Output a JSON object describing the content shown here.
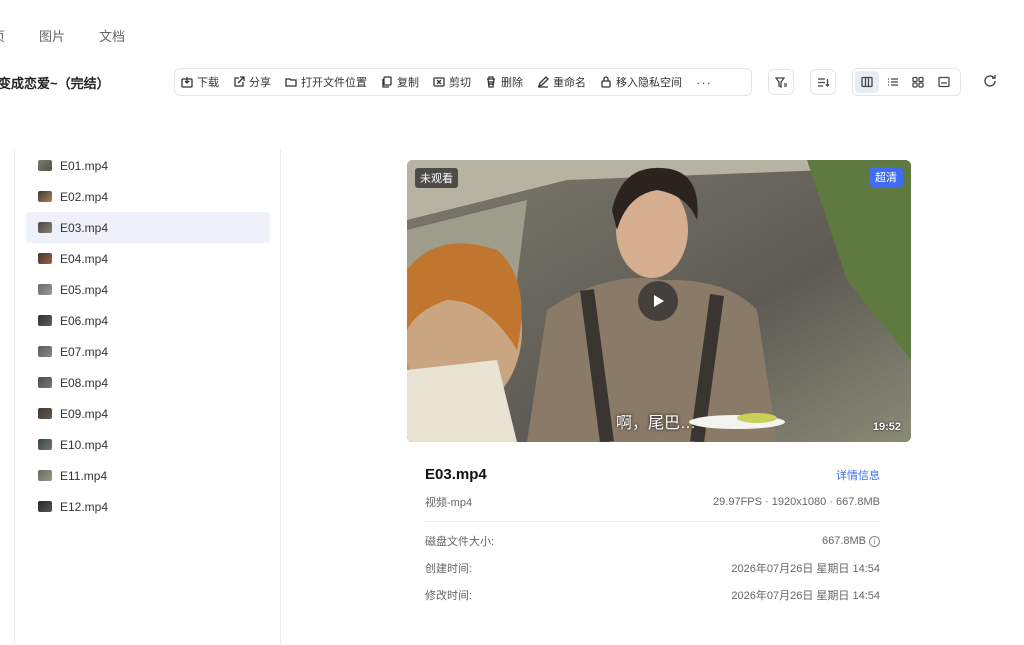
{
  "tabs": [
    "页",
    "图片",
    "文档"
  ],
  "folder_title": "变成恋爱~（完结）",
  "toolbar": {
    "download": "下载",
    "share": "分享",
    "open_location": "打开文件位置",
    "copy": "复制",
    "cut": "剪切",
    "delete": "删除",
    "rename": "重命名",
    "private": "移入隐私空间",
    "more": "···"
  },
  "files": [
    {
      "name": "E01.mp4",
      "thumb": [
        "#7a7f70",
        "#4f5248"
      ]
    },
    {
      "name": "E02.mp4",
      "thumb": [
        "#3a3a3a",
        "#b08050"
      ]
    },
    {
      "name": "E03.mp4",
      "thumb": [
        "#4a4a44",
        "#8a8070"
      ]
    },
    {
      "name": "E04.mp4",
      "thumb": [
        "#403830",
        "#a06040"
      ]
    },
    {
      "name": "E05.mp4",
      "thumb": [
        "#6a6a6a",
        "#9a9a9a"
      ]
    },
    {
      "name": "E06.mp4",
      "thumb": [
        "#303030",
        "#606060"
      ]
    },
    {
      "name": "E07.mp4",
      "thumb": [
        "#5a5a5a",
        "#8a8a8a"
      ]
    },
    {
      "name": "E08.mp4",
      "thumb": [
        "#4a4a4a",
        "#7a7a7a"
      ]
    },
    {
      "name": "E09.mp4",
      "thumb": [
        "#3a3a3a",
        "#6a5a4a"
      ]
    },
    {
      "name": "E10.mp4",
      "thumb": [
        "#3a4040",
        "#707a7a"
      ]
    },
    {
      "name": "E11.mp4",
      "thumb": [
        "#6a6a5a",
        "#9a9a8a"
      ]
    },
    {
      "name": "E12.mp4",
      "thumb": [
        "#2a2a2a",
        "#555555"
      ]
    }
  ],
  "selected_index": 2,
  "preview": {
    "unwatched": "未观看",
    "quality": "超清",
    "subtitle": "啊，尾巴…",
    "duration": "19:52"
  },
  "info": {
    "filename": "E03.mp4",
    "detail_link": "详情信息",
    "type": "视频-mp4",
    "specs": "29.97FPS · 1920x1080 · 667.8MB",
    "size_label": "磁盘文件大小:",
    "size_value": "667.8MB",
    "created_label": "创建时间:",
    "created_value": "2026年07月26日 星期日 14:54",
    "modified_label": "修改时间:",
    "modified_value": "2026年07月26日 星期日 14:54"
  },
  "colors": {
    "accent": "#3f6cf0",
    "selected_bg": "#eef1fa"
  }
}
